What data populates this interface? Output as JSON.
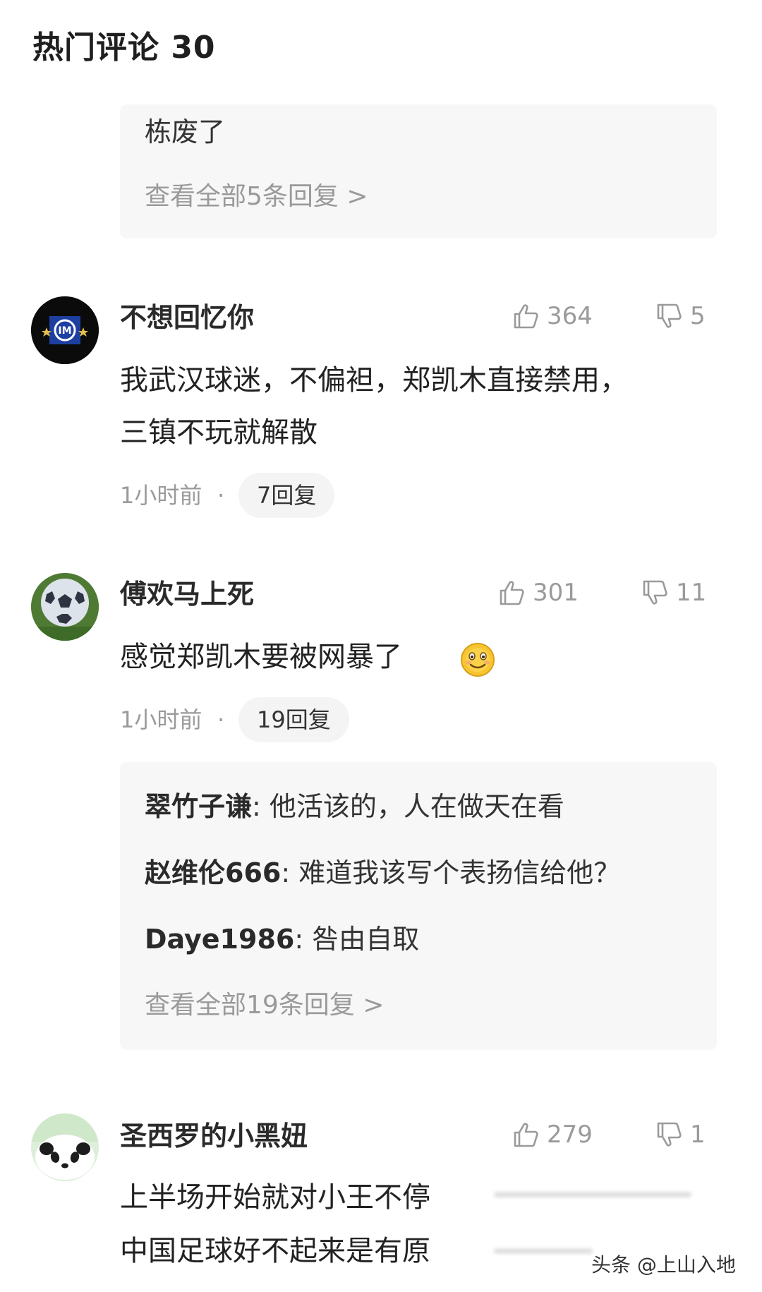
{
  "section": {
    "title": "热门评论 30"
  },
  "top_reply_box": {
    "text": "栋废了",
    "view_all": "查看全部5条回复 >"
  },
  "comments": [
    {
      "username": "不想回忆你",
      "likes": "364",
      "dislikes": "5",
      "lines": [
        "我武汉球迷，不偏袒，郑凯木直接禁用，",
        "三镇不玩就解散"
      ],
      "time": "1小时前",
      "dot": "·",
      "replies": "7回复",
      "avatar_icon": "inter-milan-logo"
    },
    {
      "username": "傅欢马上死",
      "likes": "301",
      "dislikes": "11",
      "lines": [
        "感觉郑凯木要被网暴了"
      ],
      "emoji_icon": "smile-emoji-icon",
      "time": "1小时前",
      "dot": "·",
      "replies": "19回复",
      "avatar_icon": "soccer-ball",
      "sub_replies": [
        {
          "user": "翠竹子谦",
          "sep": ": ",
          "text": "他活该的，人在做天在看"
        },
        {
          "user": "赵维伦666",
          "sep": ": ",
          "text": "难道我该写个表扬信给他？"
        },
        {
          "user": "Daye1986",
          "sep": ": ",
          "text": "咎由自取"
        }
      ],
      "view_all": "查看全部19条回复 >"
    },
    {
      "username": "圣西罗的小黑妞",
      "likes": "279",
      "dislikes": "1",
      "lines": [
        "上半场开始就对小王不停",
        "中国足球好不起来是有原"
      ],
      "avatar_icon": "panda-avatar"
    }
  ],
  "watermark": "头条 @上山入地",
  "colors": {
    "muted": "#9a9a9a",
    "reply_bg": "#f7f7f8",
    "text": "#222222"
  }
}
